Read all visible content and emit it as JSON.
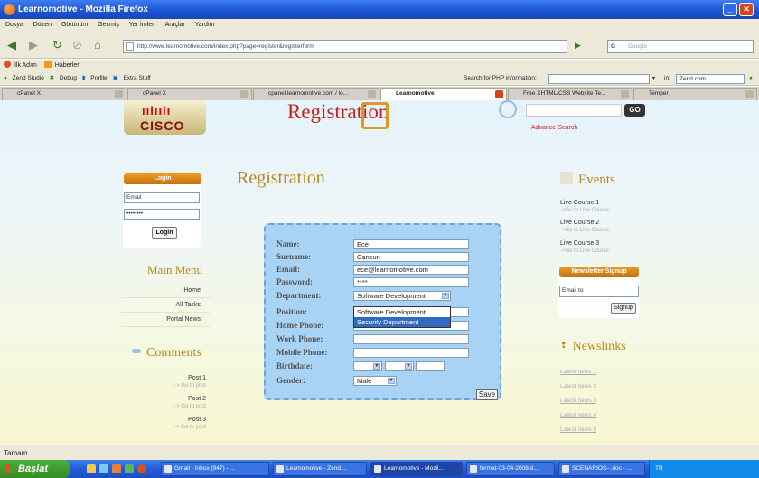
{
  "window": {
    "title": "Learnomotive - Mozilla Firefox"
  },
  "menu": [
    "Dosya",
    "Düzen",
    "Görünüm",
    "Geçmiş",
    "Yer İmleri",
    "Araçlar",
    "Yardım"
  ],
  "nav": {
    "url": "http://www.learnomotive.com/index.php?page=register&registerform",
    "search_placeholder": "Google"
  },
  "bookmarks": [
    "İlk Adım",
    "Haberler"
  ],
  "zend_toolbar": {
    "items": [
      "Zend Studio",
      "Debug",
      "Profile",
      "Extra Stuff"
    ],
    "search_label": "Search for PHP information:",
    "in_label": "in:",
    "in_value": "Zend.com"
  },
  "tabs": [
    {
      "label": "cPanel X"
    },
    {
      "label": "cPanel X"
    },
    {
      "label": "cpanel.learnomotive.com / lo..."
    },
    {
      "label": "Learnomotive",
      "active": true
    },
    {
      "label": "Free XHTML/CSS Website Te..."
    },
    {
      "label": "Temper"
    }
  ],
  "site": {
    "logo_text": "CISCO",
    "header_title": "Registration",
    "go_label": "GO",
    "advance_search": "- Advance Search"
  },
  "login": {
    "header": "Login",
    "email_value": "Email",
    "password_value": "••••••••",
    "button": "Login"
  },
  "main_menu": {
    "heading": "Main Menu",
    "items": [
      "Home",
      "All Tasks",
      "Portal News"
    ]
  },
  "comments": {
    "heading": "Comments",
    "posts": [
      {
        "title": "Post 1",
        "link": "-> Go to post"
      },
      {
        "title": "Post 2",
        "link": "-> Go to post"
      },
      {
        "title": "Post 3",
        "link": "-> Go to post"
      }
    ]
  },
  "registration": {
    "heading": "Registration",
    "fields": {
      "name": {
        "label": "Name:",
        "value": "Ece"
      },
      "surname": {
        "label": "Surname:",
        "value": "Cansun"
      },
      "email": {
        "label": "Email:",
        "value": "ece@learnomotive.com"
      },
      "password": {
        "label": "Password:",
        "value": "****"
      },
      "department": {
        "label": "Department:",
        "value": "Software Development"
      },
      "position": {
        "label": "Position:",
        "value": ""
      },
      "home_phone": {
        "label": "Home Phone:",
        "value": ""
      },
      "work_phone": {
        "label": "Work Phone:",
        "value": ""
      },
      "mobile_phone": {
        "label": "Mobile Phone:",
        "value": ""
      },
      "birthdate": {
        "label": "Birthdate:",
        "value": ""
      },
      "gender": {
        "label": "Gender:",
        "value": "Male"
      }
    },
    "department_options": [
      "Software Development",
      "Security Department"
    ],
    "save": "Save"
  },
  "events": {
    "heading": "Events",
    "items": [
      {
        "title": "Live Course 1",
        "link": "->Go to Live Course"
      },
      {
        "title": "Live Course 2",
        "link": "->Go to Live Course"
      },
      {
        "title": "Live Course 3",
        "link": "->Go to Live Course"
      }
    ]
  },
  "newsletter": {
    "header": "Newsletter Signup",
    "email_value": "Email to",
    "button": "Signup"
  },
  "newslinks": {
    "heading": "Newslinks",
    "items": [
      "Latest news 1",
      "Latest news 2",
      "Latest news 3",
      "Latest news 4",
      "Latest news 5"
    ]
  },
  "status": "Tamam",
  "taskbar": {
    "start": "Başlat",
    "tasks": [
      "Gmail - Inbox (947) - ...",
      "Learnomotive - Zend ...",
      "Learnomotive - Mozil...",
      "format-03-04-2008.d...",
      "SCENARIOS--.doc - ..."
    ],
    "tray": "TR"
  },
  "colors": {
    "accent": "#c8211b",
    "heading": "#b9861f",
    "form_panel": "#a8d3f5",
    "orange_header": "#e8a020",
    "selection": "#316ac5"
  }
}
